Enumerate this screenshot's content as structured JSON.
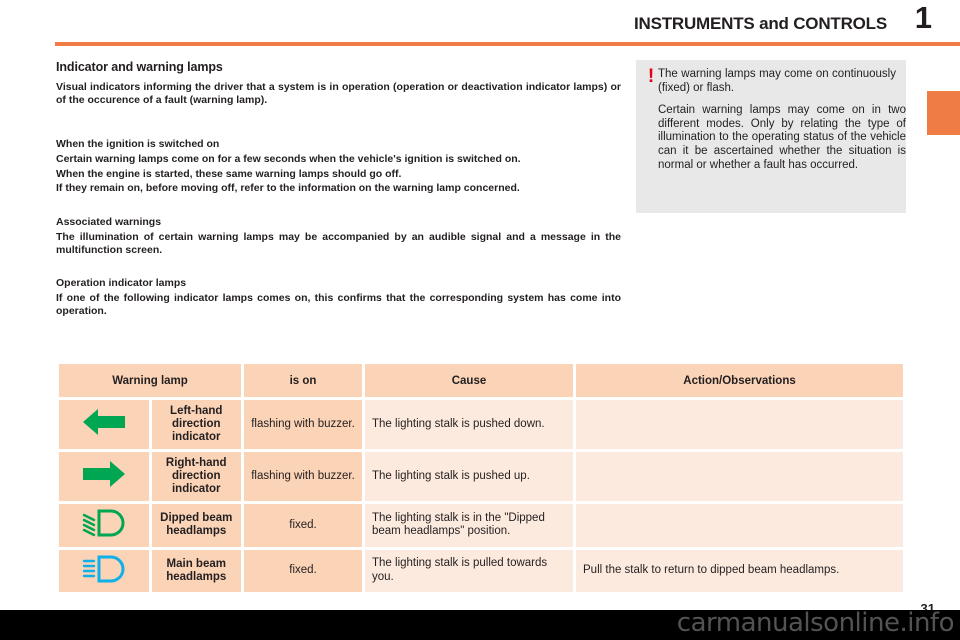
{
  "header": {
    "title": "INSTRUMENTS and CONTROLS",
    "chapter_number": "1",
    "rule_color": "#ef7b45"
  },
  "content": {
    "section_title": "Indicator and warning lamps",
    "intro": "Visual indicators informing the driver that a system is in operation (operation or deactivation indicator lamps) or of the occurence of a fault (warning lamp).",
    "ignition": {
      "title": "When the ignition is switched on",
      "line1": "Certain warning lamps come on for a few seconds when the vehicle's ignition is switched on.",
      "line2": "When the engine is started, these same warning lamps should go off.",
      "line3": "If they remain on, before moving off, refer to the information on the warning lamp concerned."
    },
    "associated": {
      "title": "Associated warnings",
      "line1": "The illumination of certain warning lamps may be accompanied by an audible signal and a message in the multifunction screen."
    },
    "operation": {
      "title": "Operation indicator lamps",
      "line1": "If one of the following indicator lamps comes on, this confirms that the corresponding system has come into operation."
    }
  },
  "warning_box": {
    "icon": "exclamation-mark-icon",
    "icon_color": "#e3001b",
    "background": "#e8e8e8",
    "paragraph1": "The warning lamps may come on continuously (fixed) or flash.",
    "paragraph2": "Certain warning lamps may come on in two different modes. Only by relating the type of illumination to the operating status of the vehicle can it be ascertained whether the situation is normal or whether a fault has occurred."
  },
  "table": {
    "headers": {
      "lamp": "Warning lamp",
      "is_on": "is on",
      "cause": "Cause",
      "action": "Action/Observations"
    },
    "header_bg": "#fbd3b6",
    "cell_bg": "#fdeade",
    "rows": [
      {
        "icon": "left-arrow-indicator-icon",
        "icon_color": "#00a651",
        "name": "Left-hand direction indicator",
        "is_on": "flashing with buzzer.",
        "cause": "The lighting stalk is pushed down.",
        "action": ""
      },
      {
        "icon": "right-arrow-indicator-icon",
        "icon_color": "#00a651",
        "name": "Right-hand direction indicator",
        "is_on": "flashing with buzzer.",
        "cause": "The lighting stalk is pushed up.",
        "action": ""
      },
      {
        "icon": "dipped-beam-headlamp-icon",
        "icon_color": "#00a651",
        "name": "Dipped beam headlamps",
        "is_on": "fixed.",
        "cause": "The lighting stalk is in the \"Dipped beam headlamps\" position.",
        "action": ""
      },
      {
        "icon": "main-beam-headlamp-icon",
        "icon_color": "#0fb0e8",
        "name": "Main beam headlamps",
        "is_on": "fixed.",
        "cause": "The lighting stalk is pulled towards you.",
        "action": "Pull the stalk to return to dipped beam headlamps."
      }
    ]
  },
  "footer": {
    "page_number": "31",
    "watermark": "carmanualsonline.info"
  }
}
